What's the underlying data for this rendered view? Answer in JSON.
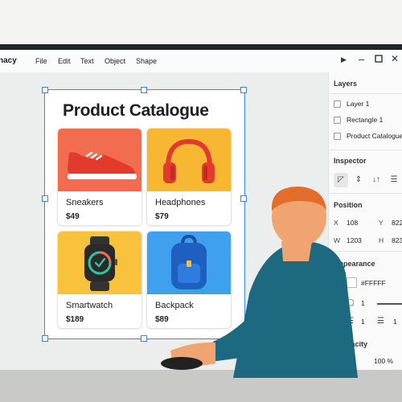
{
  "app": {
    "name": "nacy"
  },
  "menu": [
    "File",
    "Edit",
    "Text",
    "Object",
    "Shape"
  ],
  "artboard": {
    "title": "Product Catalogue",
    "products": [
      {
        "name": "Sneakers",
        "price": "$49",
        "bg": "#f26c4f",
        "icon": "sneaker-icon"
      },
      {
        "name": "Headphones",
        "price": "$79",
        "bg": "#f7b733",
        "icon": "headphones-icon"
      },
      {
        "name": "Smartwatch",
        "price": "$189",
        "bg": "#f9c23c",
        "icon": "smartwatch-icon"
      },
      {
        "name": "Backpack",
        "price": "$89",
        "bg": "#3fa0f0",
        "icon": "backpack-icon"
      }
    ]
  },
  "panel": {
    "layers_heading": "Layers",
    "layers": [
      "Layer 1",
      "Rectangle 1",
      "Product Catalogue"
    ],
    "inspector_heading": "Inspector",
    "position_heading": "Position",
    "x_label": "X",
    "x_value": "108",
    "y_label": "Y",
    "y_value": "822",
    "w_label": "W",
    "w_value": "1203",
    "h_label": "H",
    "h_value": "823",
    "appearance_heading": "Appearance",
    "fill": "#FFFFF",
    "stroke_value": "1",
    "radius_value": "1",
    "opacity_heading": "pacity",
    "opacity_value": "100 %"
  },
  "colors": {
    "selection": "#3a86e8",
    "accent_panel": "#fafafa"
  }
}
